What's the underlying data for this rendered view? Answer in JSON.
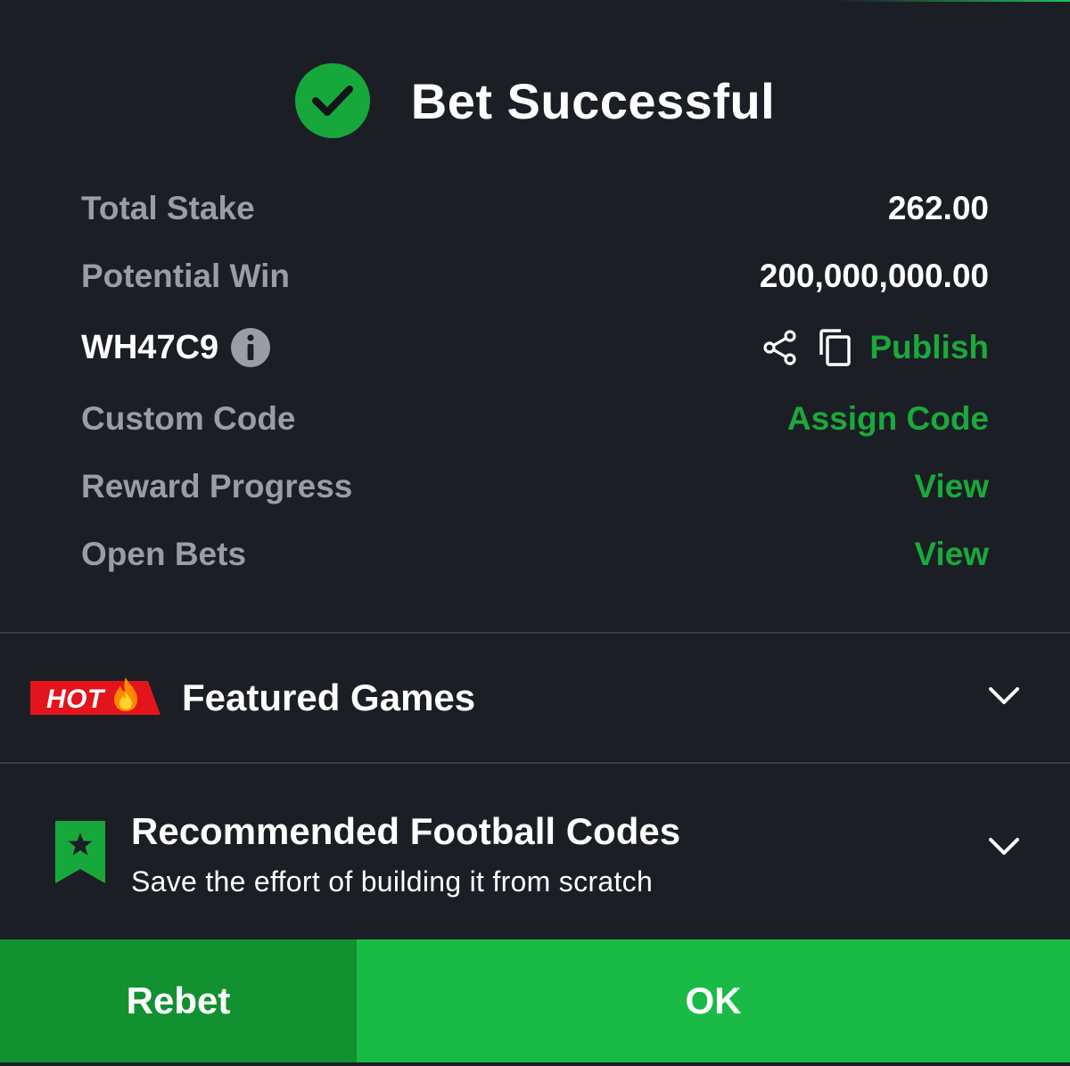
{
  "header": {
    "title": "Bet Successful",
    "icon": "check-circle-icon",
    "accent_color": "#17a83c"
  },
  "summary": {
    "total_stake_label": "Total Stake",
    "total_stake_value": "262.00",
    "potential_win_label": "Potential Win",
    "potential_win_value": "200,000,000.00",
    "booking_code": "WH47C9",
    "publish_label": "Publish",
    "custom_code_label": "Custom Code",
    "assign_code_label": "Assign Code",
    "reward_progress_label": "Reward Progress",
    "reward_progress_link": "View",
    "open_bets_label": "Open Bets",
    "open_bets_link": "View"
  },
  "featured": {
    "badge": "HOT",
    "title": "Featured Games"
  },
  "recommended": {
    "title": "Recommended Football Codes",
    "subtitle": "Save the effort of building it from scratch"
  },
  "footer": {
    "rebet_label": "Rebet",
    "ok_label": "OK"
  },
  "colors": {
    "background": "#1c1e26",
    "link_green": "#1aa93a",
    "rebet_bg": "#129131",
    "ok_bg": "#19bb46",
    "hot_red": "#e3141c"
  }
}
